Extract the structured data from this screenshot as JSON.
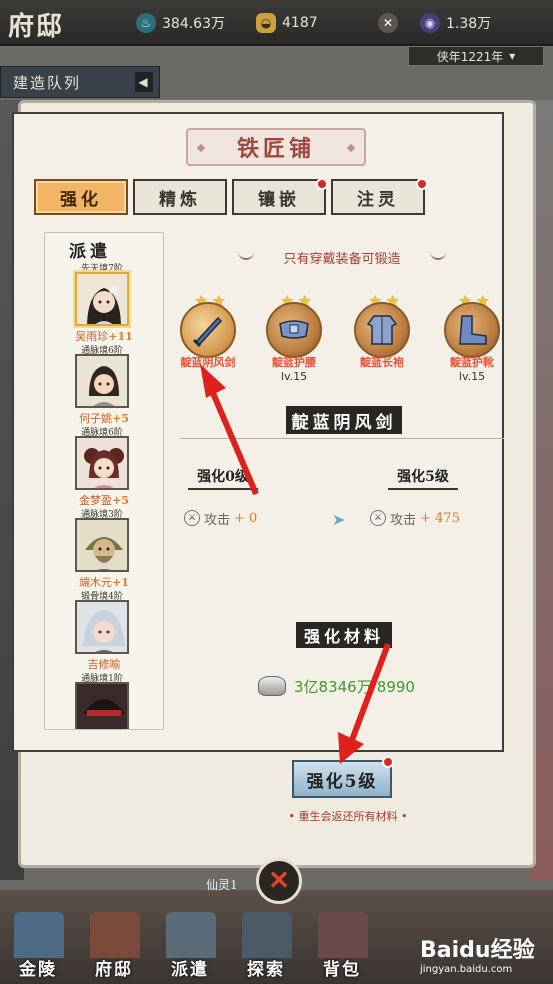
{
  "top_bar": {
    "title": "府邸",
    "resources": [
      {
        "icon": "spirit-stone-icon",
        "value": "384.63万"
      },
      {
        "icon": "gold-ingot-icon",
        "value": "4187"
      },
      {
        "icon": "sword-icon",
        "value": ""
      },
      {
        "icon": "purple-orb-icon",
        "value": "1.38万"
      }
    ],
    "year_select": "侠年1221年"
  },
  "build_queue": {
    "label": "建造队列"
  },
  "dialog": {
    "title": "铁匠铺",
    "tabs": [
      {
        "label": "强化",
        "active": true,
        "badge": false
      },
      {
        "label": "精炼",
        "active": false,
        "badge": false
      },
      {
        "label": "镶嵌",
        "active": false,
        "badge": true
      },
      {
        "label": "注灵",
        "active": false,
        "badge": true
      }
    ],
    "dispatch_label": "派遣",
    "heroes": [
      {
        "realm": "先天境7阶",
        "name": "吴雨珍",
        "bonus": "+11",
        "selected": true
      },
      {
        "realm": "通脉境6阶",
        "name": "何子姚",
        "bonus": "+5",
        "selected": false
      },
      {
        "realm": "通脉境6阶",
        "name": "金梦盈",
        "bonus": "+5",
        "selected": false
      },
      {
        "realm": "通脉境3阶",
        "name": "端木元",
        "bonus": "+1",
        "selected": false
      },
      {
        "realm": "锻骨境4阶",
        "name": "吉修喻",
        "bonus": "",
        "selected": false
      },
      {
        "realm": "通脉境1阶",
        "name": "",
        "bonus": "",
        "selected": false
      }
    ],
    "notice": "只有穿戴装备可锻造",
    "equipment": [
      {
        "name": "靛蓝阴风剑",
        "level": "",
        "icon": "sword-icon",
        "selected": true
      },
      {
        "name": "靛蓝护腰",
        "level": "lv.15",
        "icon": "belt-icon",
        "selected": false
      },
      {
        "name": "靛蓝长袍",
        "level": "",
        "icon": "robe-icon",
        "selected": false
      },
      {
        "name": "靛蓝护靴",
        "level": "lv.15",
        "icon": "boots-icon",
        "selected": false
      }
    ],
    "selected_item": "靛蓝阴风剑",
    "current": {
      "level_label": "强化0级",
      "stat_label": "攻击",
      "stat_value": "+ 0"
    },
    "next": {
      "level_label": "强化5级",
      "stat_label": "攻击",
      "stat_value": "+ 475"
    },
    "materials_title": "强化材料",
    "materials_value": "3亿8346万/8990",
    "upgrade_button": "强化5级",
    "rebirth_note": "• 重生会返还所有材料 •"
  },
  "bottom": {
    "xian_ling": "仙灵1",
    "nav": [
      "金陵",
      "府邸",
      "派遣",
      "探索",
      "背包"
    ]
  },
  "watermark": {
    "brand": "Baidu经验",
    "url": "jingyan.baidu.com"
  },
  "colors": {
    "accent_red": "#d32a21",
    "tab_active": "#f2b565",
    "bonus_orange": "#e67a22",
    "material_green": "#3c9a2a"
  }
}
